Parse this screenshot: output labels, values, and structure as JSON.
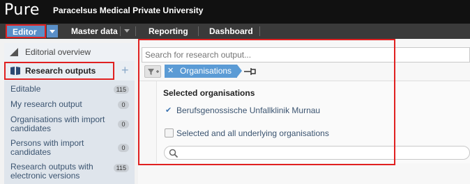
{
  "header": {
    "logo": "Pure",
    "org": "Paracelsus Medical Private University"
  },
  "nav": {
    "items": [
      {
        "label": "Editor"
      },
      {
        "label": "Master data"
      },
      {
        "label": "Reporting"
      },
      {
        "label": "Dashboard"
      }
    ]
  },
  "sidebar": {
    "overview": "Editorial overview",
    "research_outputs": "Research outputs",
    "items": [
      {
        "label": "Editable",
        "count": "115"
      },
      {
        "label": "My research output",
        "count": "0"
      },
      {
        "label": "Organisations with import candidates",
        "count": "0"
      },
      {
        "label": "Persons with import candidates",
        "count": "0"
      },
      {
        "label": "Research outputs with electronic versions",
        "count": "115"
      }
    ]
  },
  "main": {
    "search_placeholder": "Search for research output...",
    "filter_tag": "Organisations",
    "selected_title": "Selected organisations",
    "selected_option": "Berufsgenossische Unfallklinik Murnau",
    "checkbox_label": "Selected and all underlying organisations"
  },
  "colors": {
    "accent": "#5b9bd5",
    "highlight": "#e02020",
    "header": "#111111"
  }
}
